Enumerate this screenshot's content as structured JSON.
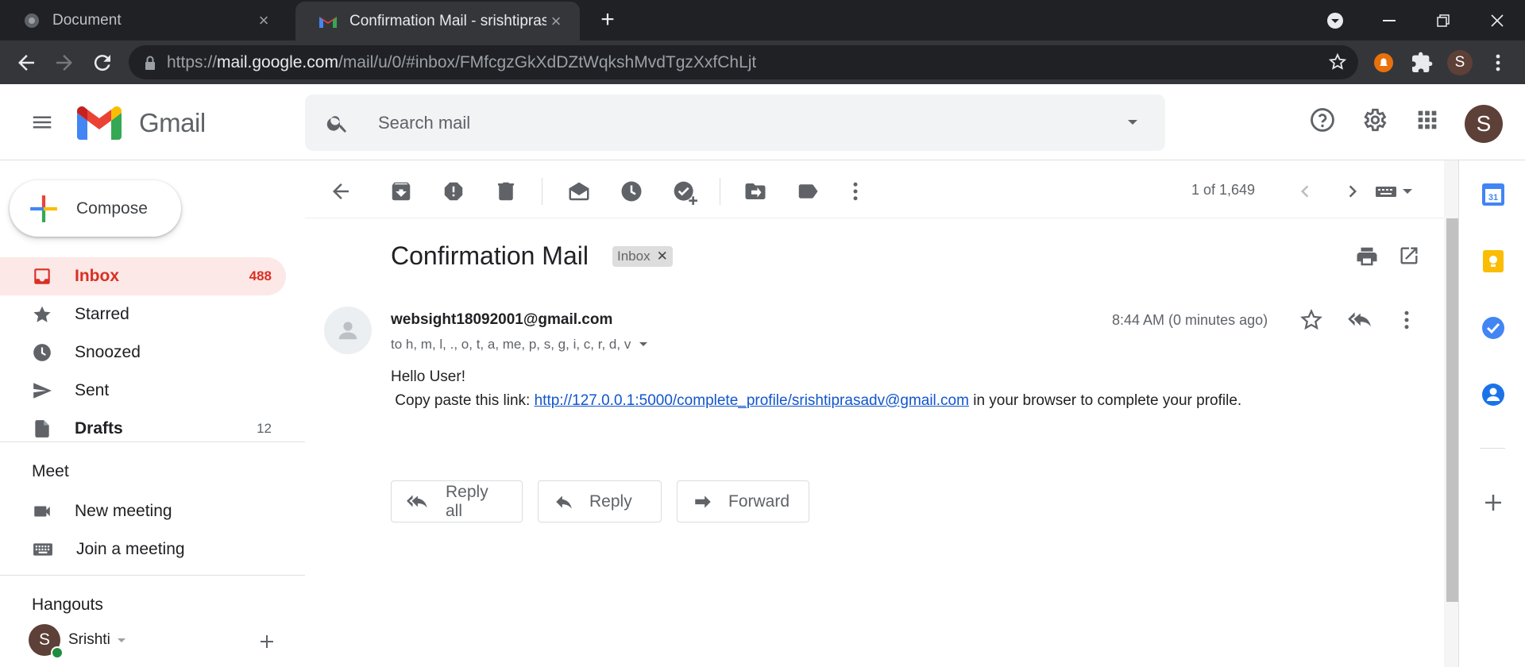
{
  "browser": {
    "tabs": [
      {
        "title": "Document",
        "icon": "globe-icon"
      },
      {
        "title": "Confirmation Mail - srishtiprasad",
        "icon": "gmail-icon"
      }
    ],
    "url_scheme": "https://",
    "url_domain": "mail.google.com",
    "url_path": "/mail/u/0/#inbox/FMfcgzGkXdDZtWqkshMvdTgzXxfChLjt",
    "profile_initial": "S"
  },
  "gmail": {
    "app_name": "Gmail",
    "search_placeholder": "Search mail",
    "account_initial": "S"
  },
  "sidebar": {
    "compose_label": "Compose",
    "items": [
      {
        "label": "Inbox",
        "count": "488",
        "icon": "inbox-icon"
      },
      {
        "label": "Starred",
        "count": "",
        "icon": "star-icon"
      },
      {
        "label": "Snoozed",
        "count": "",
        "icon": "clock-icon"
      },
      {
        "label": "Sent",
        "count": "",
        "icon": "send-icon"
      },
      {
        "label": "Drafts",
        "count": "12",
        "icon": "draft-icon"
      }
    ],
    "meet": {
      "heading": "Meet",
      "items": [
        {
          "label": "New meeting",
          "icon": "video-icon"
        },
        {
          "label": "Join a meeting",
          "icon": "keyboard-icon"
        }
      ]
    },
    "hangouts": {
      "heading": "Hangouts",
      "user_name": "Srishti",
      "user_initial": "S"
    }
  },
  "toolbar": {
    "pager": "1 of 1,649"
  },
  "email": {
    "subject": "Confirmation Mail",
    "label": "Inbox",
    "sender": "websight18092001@gmail.com",
    "recipients": "to h, m, l, ., o, t, a, me, p, s, g, i, c, r, d, v",
    "time": "8:44 AM (0 minutes ago)",
    "greeting": "Hello User!",
    "body_prefix": "Copy paste this link: ",
    "link": "http://127.0.0.1:5000/complete_profile/srishtiprasadv@gmail.com",
    "body_suffix": " in your browser to complete your profile."
  },
  "actions": {
    "reply_all": "Reply all",
    "reply": "Reply",
    "forward": "Forward"
  },
  "colors": {
    "accent_red": "#d93025",
    "active_bg": "#fce8e6",
    "link": "#1155cc"
  }
}
